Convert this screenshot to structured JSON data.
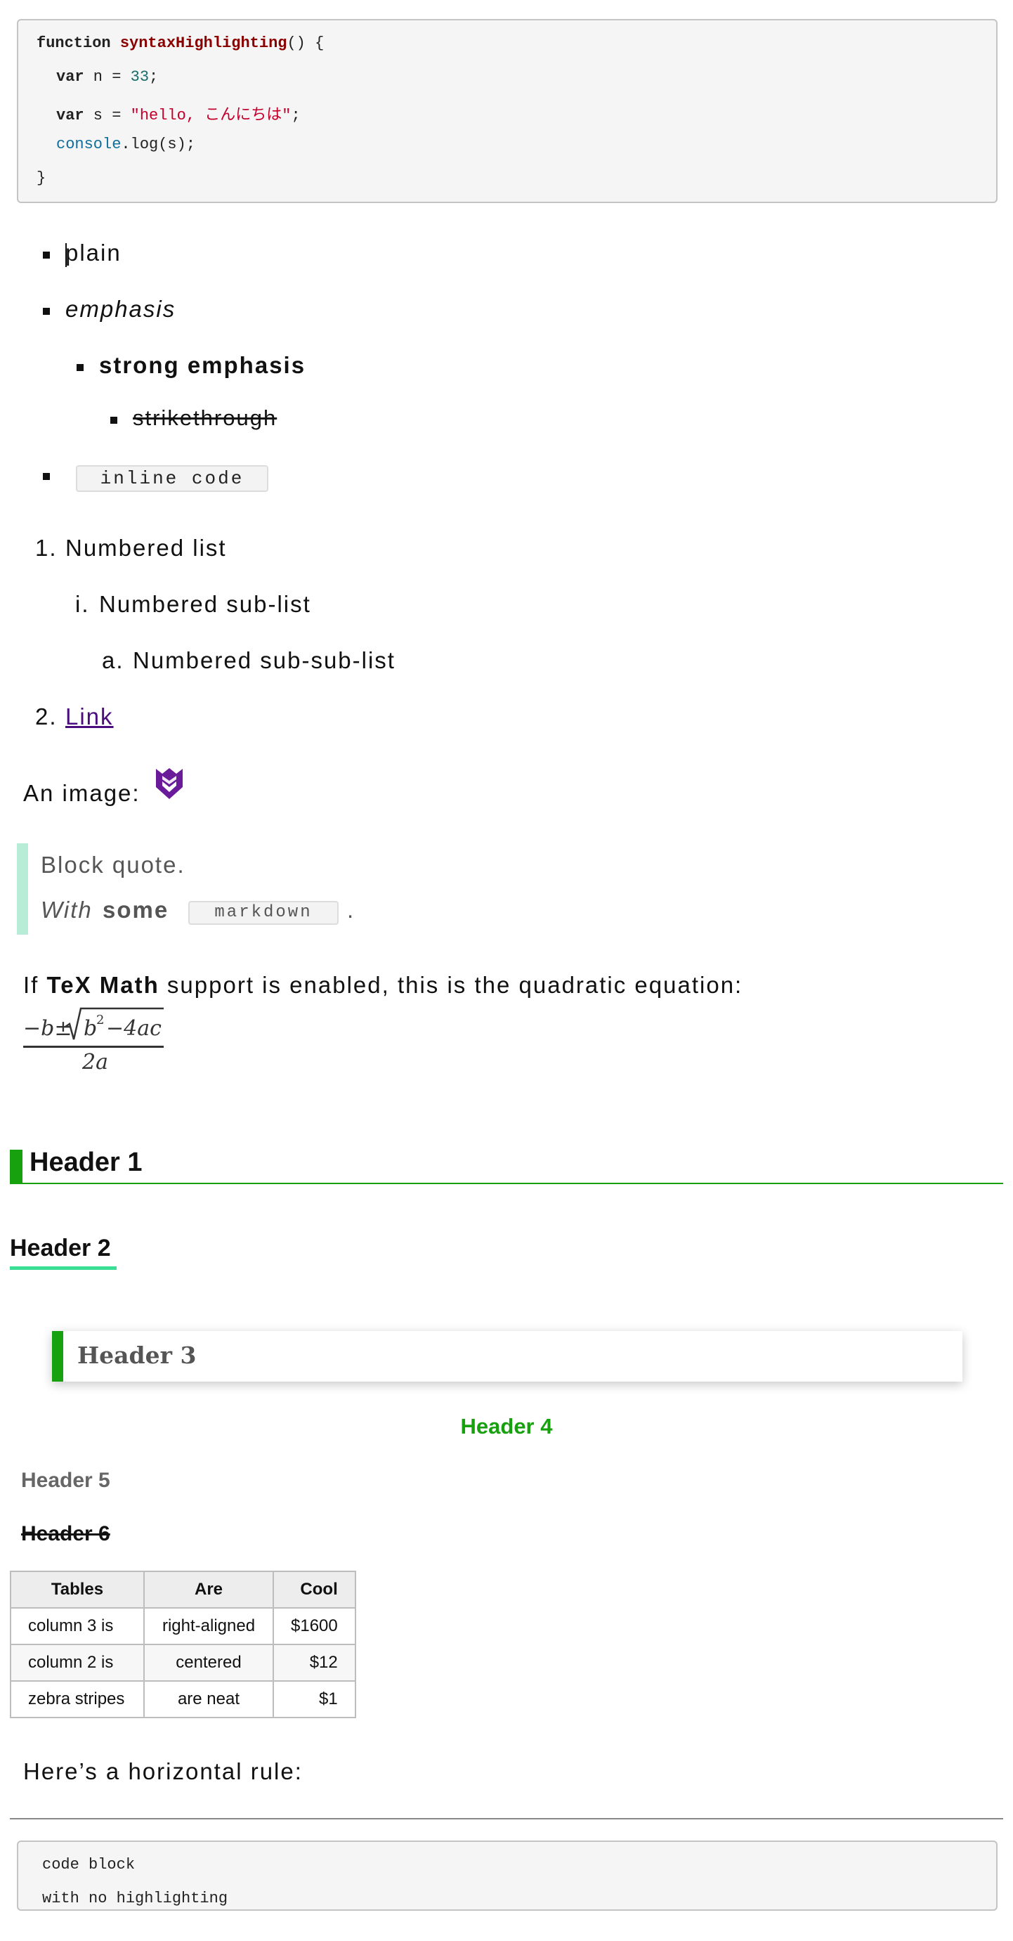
{
  "code_block": {
    "kw_function": "function",
    "fn_name": "syntaxHighlighting",
    "fn_tail": "() {",
    "kw_var": "var",
    "n_assign": " n = ",
    "n_value": "33",
    "semi": ";",
    "s_assign": " s = ",
    "s_value": "\"hello, こんにちは\"",
    "console_obj": "console",
    "console_call": ".log(s);",
    "close_brace": "}"
  },
  "bullets": {
    "plain": "plain",
    "emphasis": "emphasis",
    "strong": "strong emphasis",
    "strike": "strikethrough",
    "inline_code": "inline code"
  },
  "numbered": {
    "item1_marker": "1.",
    "item1": "Numbered list",
    "sub_marker": "i.",
    "sub": "Numbered sub-list",
    "subsub_marker": "a.",
    "subsub": "Numbered sub-sub-list",
    "item2_marker": "2.",
    "link": "Link"
  },
  "image_label": "An image:",
  "blockquote": {
    "line1": "Block quote.",
    "with": "With",
    "some": "some",
    "code": "markdown",
    "period": "."
  },
  "tex": {
    "if": "If",
    "bold": "TeX Math",
    "rest": "support is enabled, this is the quadratic equation:"
  },
  "headers": {
    "h1": "Header 1",
    "h2": "Header 2",
    "h3": "Header 3",
    "h4": "Header 4",
    "h5": "Header 5",
    "h6": "Header 6"
  },
  "table": {
    "headers": [
      "Tables",
      "Are",
      "Cool"
    ],
    "rows": [
      [
        "column 3 is",
        "right-aligned",
        "$1600"
      ],
      [
        "column 2 is",
        "centered",
        "$12"
      ],
      [
        "zebra stripes",
        "are neat",
        "$1"
      ]
    ]
  },
  "hr_label": "Here’s a horizontal rule:",
  "code_block_2": {
    "line1": "code block",
    "line2": "with no highlighting"
  },
  "colors": {
    "accent_green": "#18a10f",
    "mint": "#39e093",
    "link_purple": "#4b0c7e",
    "logo_purple": "#6a1b9a"
  }
}
